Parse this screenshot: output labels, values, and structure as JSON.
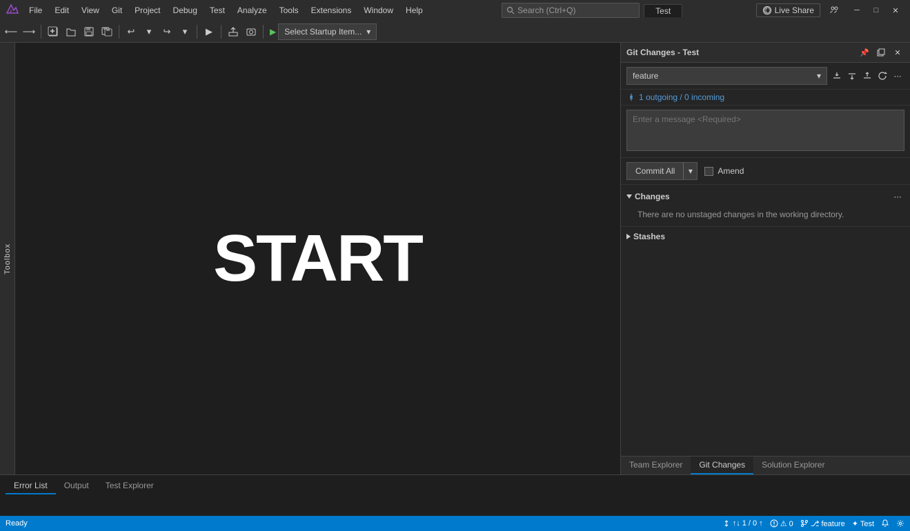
{
  "titleBar": {
    "logo": "VS",
    "menus": [
      "File",
      "Edit",
      "View",
      "Git",
      "Project",
      "Debug",
      "Test",
      "Analyze",
      "Tools",
      "Extensions",
      "Window",
      "Help"
    ],
    "searchPlaceholder": "Search (Ctrl+Q)",
    "projectTab": "Test",
    "liveShare": "Live Share",
    "winControls": {
      "minimize": "─",
      "maximize": "□",
      "close": "✕"
    }
  },
  "toolbar": {
    "undoLabel": "↩",
    "redoLabel": "↪",
    "runDropdown": "Select Startup Item...",
    "runDropdownArrow": "▾"
  },
  "toolbox": {
    "label": "Toolbox"
  },
  "editor": {
    "mainText": "START"
  },
  "gitPanel": {
    "title": "Git Changes - Test",
    "branch": "feature",
    "syncLink": "1 outgoing / 0 incoming",
    "commitPlaceholder": "Enter a message <Required>",
    "commitAllLabel": "Commit All",
    "amendLabel": "Amend",
    "changes": {
      "title": "Changes",
      "emptyMsg": "There are no unstaged changes in the working directory."
    },
    "stashes": {
      "title": "Stashes"
    },
    "tabs": {
      "teamExplorer": "Team Explorer",
      "gitChanges": "Git Changes",
      "solutionExplorer": "Solution Explorer"
    }
  },
  "bottomPanel": {
    "tabs": [
      "Error List",
      "Output",
      "Test Explorer"
    ]
  },
  "statusBar": {
    "ready": "Ready",
    "syncStatus": "↑↓ 1 / 0 ↑",
    "errors": "⚠ 0",
    "branch": "⎇ feature",
    "project": "✦ Test",
    "bell": "🔔"
  }
}
